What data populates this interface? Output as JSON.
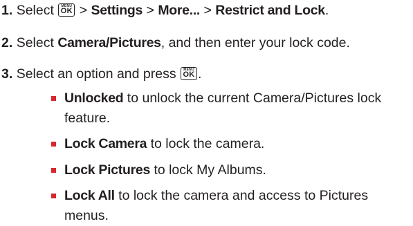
{
  "steps": [
    {
      "number": "1.",
      "text_a": "Select",
      "key_top": "MENU",
      "key_main": "OK",
      "sep": ">",
      "path_settings": "Settings",
      "path_more": "More...",
      "path_restrict": "Restrict and Lock",
      "end": "."
    },
    {
      "number": "2.",
      "text_a": "Select",
      "bold": "Camera/Pictures",
      "text_b": ", and then enter your lock code."
    },
    {
      "number": "3.",
      "text_a": "Select an option and press",
      "key_top": "MENU",
      "key_main": "OK",
      "end": "."
    }
  ],
  "options": [
    {
      "label": "Unlocked",
      "line1": " to unlock the current Camera/Pictures lock",
      "line2": "feature."
    },
    {
      "label": "Lock Camera",
      "line1": " to lock the camera."
    },
    {
      "label": "Lock Pictures",
      "line1": " to lock My Albums."
    },
    {
      "label": "Lock All",
      "line1": " to lock the camera and access to Pictures",
      "line2": "menus."
    }
  ],
  "colors": {
    "text": "#231f20",
    "bullet": "#d7282f"
  }
}
